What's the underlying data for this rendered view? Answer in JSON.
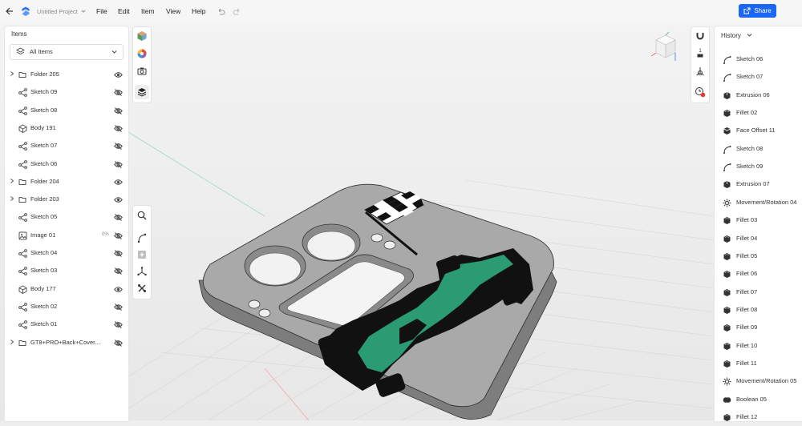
{
  "topbar": {
    "project_title": "Untitled Project",
    "menu": [
      "File",
      "Edit",
      "Item",
      "View",
      "Help"
    ],
    "share_label": "Share"
  },
  "items_panel": {
    "title": "Items",
    "filter_label": "All Items",
    "rows": [
      {
        "label": "Folder 205",
        "type": "folder",
        "visible": true
      },
      {
        "label": "Sketch 09",
        "type": "sketch",
        "visible": false
      },
      {
        "label": "Sketch 08",
        "type": "sketch",
        "visible": false
      },
      {
        "label": "Body 191",
        "type": "body",
        "visible": false
      },
      {
        "label": "Sketch 07",
        "type": "sketch",
        "visible": false
      },
      {
        "label": "Sketch 06",
        "type": "sketch",
        "visible": false
      },
      {
        "label": "Folder 204",
        "type": "folder",
        "visible": true
      },
      {
        "label": "Folder 203",
        "type": "folder",
        "visible": true
      },
      {
        "label": "Sketch 05",
        "type": "sketch",
        "visible": false
      },
      {
        "label": "Image 01",
        "type": "image",
        "visible": false,
        "opacity": "0%"
      },
      {
        "label": "Sketch 04",
        "type": "sketch",
        "visible": false
      },
      {
        "label": "Sketch 03",
        "type": "sketch",
        "visible": false
      },
      {
        "label": "Body 177",
        "type": "body",
        "visible": true
      },
      {
        "label": "Sketch 02",
        "type": "sketch",
        "visible": false
      },
      {
        "label": "Sketch 01",
        "type": "sketch",
        "visible": false
      },
      {
        "label": "GT8+PRO+Back+Cover...",
        "type": "folder",
        "visible": false
      }
    ]
  },
  "history_panel": {
    "title": "History",
    "rows": [
      {
        "label": "Sketch 06",
        "type": "sketch"
      },
      {
        "label": "Sketch 07",
        "type": "sketch"
      },
      {
        "label": "Extrusion 06",
        "type": "extrusion"
      },
      {
        "label": "Fillet 02",
        "type": "fillet"
      },
      {
        "label": "Face Offset 11",
        "type": "offset"
      },
      {
        "label": "Sketch 08",
        "type": "sketch"
      },
      {
        "label": "Sketch 09",
        "type": "sketch"
      },
      {
        "label": "Extrusion 07",
        "type": "extrusion"
      },
      {
        "label": "Movement/Rotation 04",
        "type": "move"
      },
      {
        "label": "Fillet 03",
        "type": "fillet"
      },
      {
        "label": "Fillet 04",
        "type": "fillet"
      },
      {
        "label": "Fillet 05",
        "type": "fillet"
      },
      {
        "label": "Fillet 06",
        "type": "fillet"
      },
      {
        "label": "Fillet 07",
        "type": "fillet"
      },
      {
        "label": "Fillet 08",
        "type": "fillet"
      },
      {
        "label": "Fillet 09",
        "type": "fillet"
      },
      {
        "label": "Fillet 10",
        "type": "fillet"
      },
      {
        "label": "Fillet 11",
        "type": "fillet"
      },
      {
        "label": "Movement/Rotation 05",
        "type": "move"
      },
      {
        "label": "Boolean 05",
        "type": "boolean"
      },
      {
        "label": "Fillet 12",
        "type": "fillet"
      }
    ]
  },
  "view_toolbar": {
    "snap_value": "1"
  },
  "colors": {
    "accent": "#1b66f2",
    "model_body": "#a9a9a9",
    "car_green": "#2a9b72",
    "decal_black": "#111111",
    "alert_red": "#e53935"
  }
}
